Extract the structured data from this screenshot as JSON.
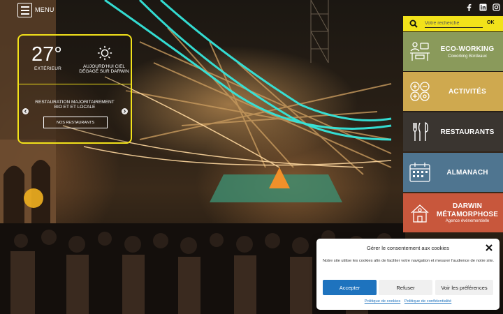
{
  "header": {
    "menu_label": "MENU"
  },
  "weather": {
    "temperature": "27°",
    "temp_caption": "EXTÉRIEUR",
    "weather_icon": "sun-icon",
    "description": "AUJOURD'HUI CIEL DÉGAGÉ SUR DARWIN"
  },
  "carousel": {
    "text": "RESTAURATION MAJORITAIREMENT BIO ET ET LOCALE",
    "button_label": "NOS RESTAURANTS"
  },
  "social": {
    "icons": [
      "facebook-icon",
      "linkedin-icon",
      "instagram-icon"
    ]
  },
  "search": {
    "placeholder": "Votre recherche",
    "submit_label": "OK"
  },
  "tiles": [
    {
      "title": "ECO-WORKING",
      "subtitle": "Coworking Bordeaux",
      "color": "#8a9a5b",
      "icon": "coworking-icon"
    },
    {
      "title": "ACTIVITÉS",
      "subtitle": "",
      "color": "#cfa94f",
      "icon": "activities-icon"
    },
    {
      "title": "RESTAURANTS",
      "subtitle": "",
      "color": "#3a3530",
      "icon": "cutlery-icon"
    },
    {
      "title": "ALMANACH",
      "subtitle": "",
      "color": "#4f7590",
      "icon": "calendar-icon"
    },
    {
      "title": "DARWIN MÉTAMORPHOSE",
      "subtitle": "Agence événementielle",
      "color": "#c8573c",
      "icon": "house-icon"
    }
  ],
  "cookie": {
    "title": "Gérer le consentement aux cookies",
    "text": "Notre site utilise les cookies afin de faciliter votre navigation et mesurer l'audience de notre site.",
    "accept_label": "Accepter",
    "refuse_label": "Refuser",
    "prefs_label": "Voir les préférences",
    "link_cookies": "Politique de cookies",
    "link_privacy": "Politique de confidentialité"
  },
  "colors": {
    "accent_yellow": "#f2e21a",
    "button_blue": "#1e73be"
  }
}
